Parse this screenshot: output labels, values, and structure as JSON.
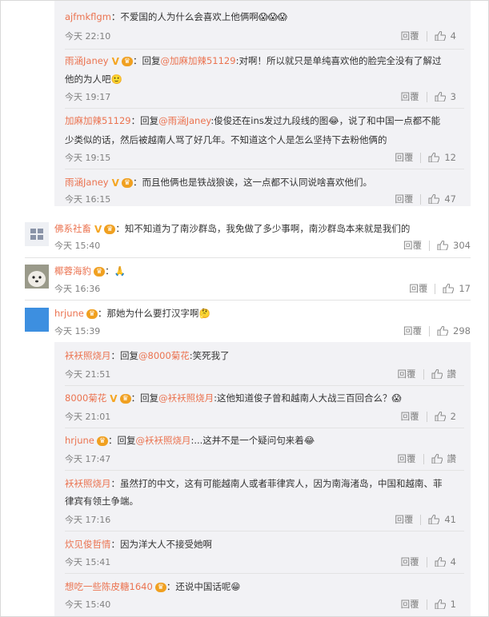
{
  "comments": [
    {
      "user": "ajfmkflgm",
      "text": "：不爱国的人为什么会喜欢上他俩啊",
      "time": "今天 22:10",
      "reply": "回覆",
      "likes": "4"
    },
    {
      "user": "雨涵Janey",
      "mention": "@加麻加辣51129",
      "text1": "：回复",
      "text2": ":对啊！所以就只是单纯喜欢他的脸完全没有了解过",
      "text3": "他的为人吧",
      "time": "今天 19:17",
      "reply": "回覆",
      "likes": "3"
    },
    {
      "user": "加麻加辣51129",
      "text1": "：回复",
      "mention": "@雨涵Janey",
      "text2": ":俊俊还在ins发过九段线的图",
      "text3": "，说了和中国一点都不能",
      "text4": "少类似的话，然后被越南人骂了好几年。不知道这个人是怎么坚持下去粉他俩的",
      "time": "今天 19:15",
      "reply": "回覆",
      "likes": "12"
    },
    {
      "user": "雨涵Janey",
      "text": "：而且他俩也是铁战狼诶，这一点都不认同说啥喜欢他们。",
      "time": "今天 16:15",
      "reply": "回覆",
      "likes": "47"
    },
    {
      "user": "佛系社畜",
      "text": "：知不知道为了南沙群岛，我免做了多少事啊，南沙群岛本来就是我们的",
      "time": "今天 15:40",
      "reply": "回覆",
      "likes": "304"
    },
    {
      "user": "椰蓉海豹",
      "text": "：",
      "time": "今天 16:36",
      "reply": "回覆",
      "likes": "17"
    },
    {
      "user": "hrjune",
      "text": "：那她为什么要打汉字啊",
      "time": "今天 15:39",
      "reply": "回覆",
      "likes": "298"
    },
    {
      "user": "袄袄照烧月",
      "text1": "：回复",
      "mention": "@8000菊花",
      "text2": ":笑死我了",
      "time": "今天 21:51",
      "reply": "回覆",
      "likes": "讚"
    },
    {
      "user": "8000菊花",
      "text1": "：回复",
      "mention": "@袄袄照烧月",
      "text2": ":这他知道俊子曾和越南人大战三百回合么？",
      "time": "今天 21:01",
      "reply": "回覆",
      "likes": "2"
    },
    {
      "user": "hrjune",
      "text1": "：回复",
      "mention": "@袄袄照烧月",
      "text2": ":...这并不是一个疑问句来着",
      "time": "今天 17:47",
      "reply": "回覆",
      "likes": "讚"
    },
    {
      "user": "袄袄照烧月",
      "text1": "：虽然打的中文，这有可能越南人或者菲律宾人，因为南海渚岛，中国和越南、菲",
      "text2": "律宾有领土争端。",
      "time": "今天 17:16",
      "reply": "回覆",
      "likes": "41"
    },
    {
      "user": "炊见俊哲情",
      "text": "：因为洋大人不接受她啊",
      "time": "今天 15:41",
      "reply": "回覆",
      "likes": "4"
    },
    {
      "user": "想吃一些陈皮糖1640",
      "text": "：还说中国话呢",
      "time": "今天 15:40",
      "reply": "回覆",
      "likes": "1"
    }
  ],
  "badge_label": "♛",
  "v_label": "V"
}
